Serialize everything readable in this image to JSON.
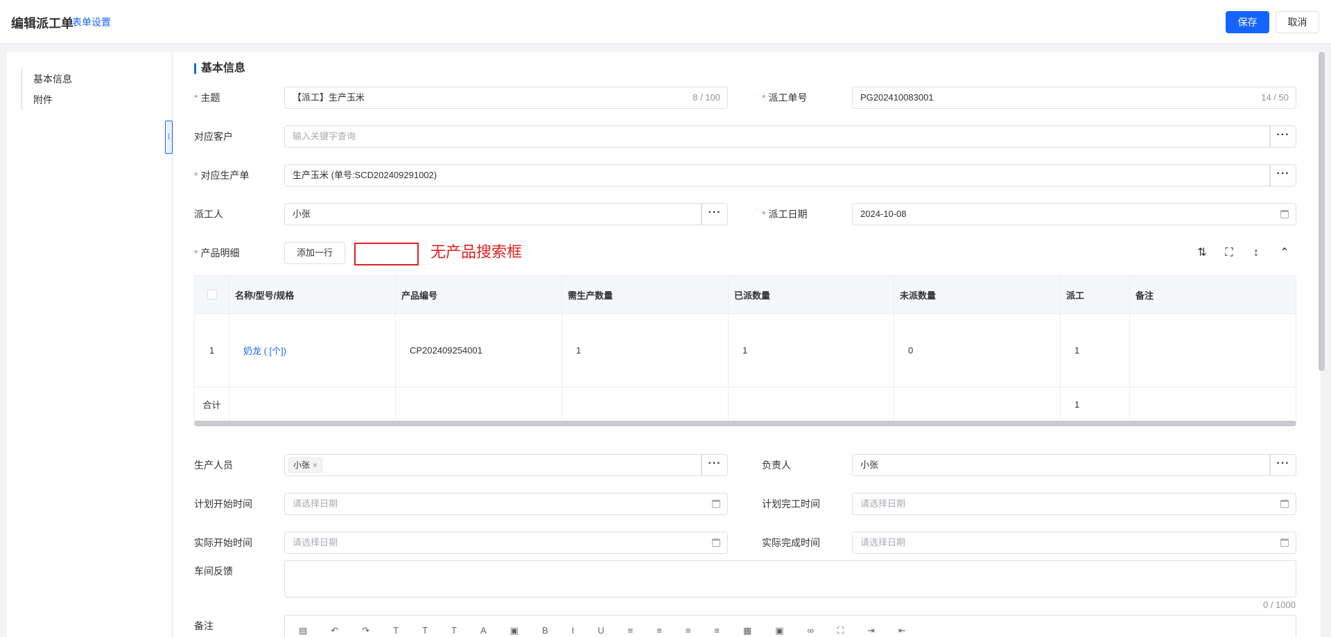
{
  "header": {
    "title": "编辑派工单",
    "form_settings": "表单设置",
    "save": "保存",
    "cancel": "取消"
  },
  "sidebar": {
    "items": [
      {
        "label": "基本信息"
      },
      {
        "label": "附件"
      }
    ]
  },
  "section": {
    "title": "基本信息"
  },
  "form": {
    "subject": {
      "label": "主题",
      "value": "【派工】生产玉米",
      "count": "8 / 100"
    },
    "order_no": {
      "label": "派工单号",
      "value": "PG202410083001",
      "count": "14 / 50"
    },
    "customer": {
      "label": "对应客户",
      "placeholder": "输入关键字查询"
    },
    "production_order": {
      "label": "对应生产单",
      "value": "生产玉米 (单号:SCD202409291002)"
    },
    "dispatcher": {
      "label": "派工人",
      "value": "小张"
    },
    "dispatch_date": {
      "label": "派工日期",
      "value": "2024-10-08"
    },
    "product_detail": {
      "label": "产品明细",
      "add_row": "添加一行"
    },
    "production_staff": {
      "label": "生产人员",
      "tag": "小张"
    },
    "owner": {
      "label": "负责人",
      "value": "小张"
    },
    "plan_start": {
      "label": "计划开始时间",
      "placeholder": "请选择日期"
    },
    "plan_end": {
      "label": "计划完工时间",
      "placeholder": "请选择日期"
    },
    "actual_start": {
      "label": "实际开始时间",
      "placeholder": "请选择日期"
    },
    "actual_end": {
      "label": "实际完成时间",
      "placeholder": "请选择日期"
    },
    "feedback": {
      "label": "车间反馈",
      "count": "0 / 1000"
    },
    "remark": {
      "label": "备注"
    }
  },
  "annotation": {
    "note": "无产品搜索框"
  },
  "table": {
    "headers": [
      "名称/型号/规格",
      "产品编号",
      "需生产数量",
      "已派数量",
      "未派数量",
      "派工",
      "备注"
    ],
    "rows": [
      {
        "index": "1",
        "name": "奶龙 ( [个])",
        "code": "CP202409254001",
        "required": "1",
        "dispatched": "1",
        "remaining": "0",
        "dispatch": "1",
        "remark": ""
      }
    ],
    "summary": {
      "label": "合计",
      "dispatch": "1"
    }
  }
}
